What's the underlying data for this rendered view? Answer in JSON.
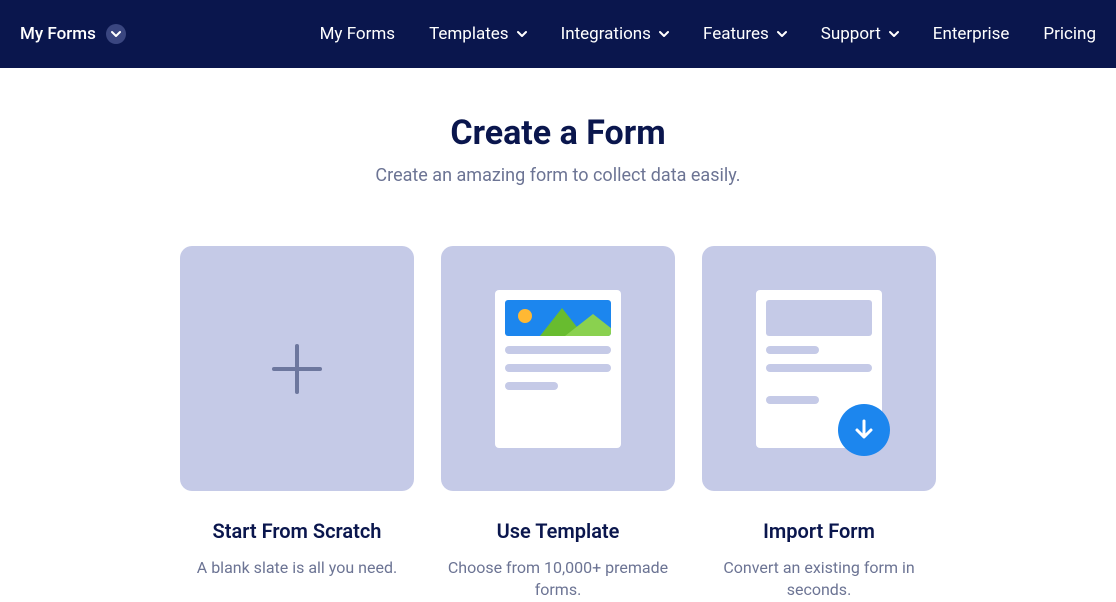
{
  "nav": {
    "brand": "My Forms",
    "items": [
      {
        "label": "My Forms",
        "dropdown": false
      },
      {
        "label": "Templates",
        "dropdown": true
      },
      {
        "label": "Integrations",
        "dropdown": true
      },
      {
        "label": "Features",
        "dropdown": true
      },
      {
        "label": "Support",
        "dropdown": true
      },
      {
        "label": "Enterprise",
        "dropdown": false
      },
      {
        "label": "Pricing",
        "dropdown": false
      }
    ]
  },
  "main": {
    "title": "Create a Form",
    "subtitle": "Create an amazing form to collect data easily."
  },
  "cards": [
    {
      "title": "Start From Scratch",
      "desc": "A blank slate is all you need."
    },
    {
      "title": "Use Template",
      "desc": "Choose from 10,000+ premade forms."
    },
    {
      "title": "Import Form",
      "desc": "Convert an existing form in seconds."
    }
  ]
}
